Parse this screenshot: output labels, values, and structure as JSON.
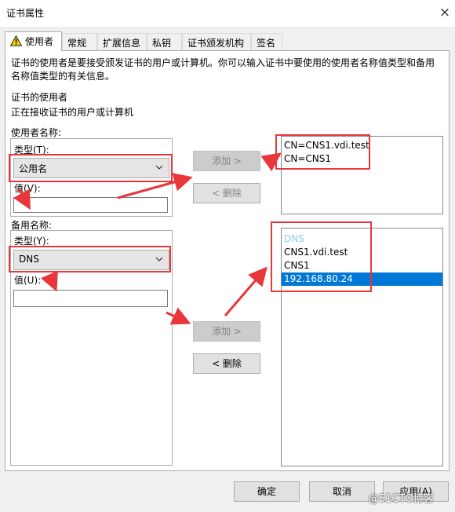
{
  "window": {
    "title": "证书属性",
    "close_glyph": "×"
  },
  "tabs": [
    {
      "label": "使用者",
      "active": true,
      "icon": "warning-icon"
    },
    {
      "label": "常规"
    },
    {
      "label": "扩展信息"
    },
    {
      "label": "私钥"
    },
    {
      "label": "证书颁发机构"
    },
    {
      "label": "签名"
    }
  ],
  "description": {
    "line1": "证书的使用者是要接受颁发证书的用户或计算机。你可以输入证书中要使用的使用者名称值类型和备用",
    "line2": "名称值类型的有关信息。"
  },
  "subject": {
    "heading": "证书的使用者",
    "text": "正在接收证书的用户或计算机"
  },
  "subject_name": {
    "group_label": "使用者名称:",
    "type_label": "类型(T):",
    "type_value": "公用名",
    "value_label": "值(V):",
    "value_input": "",
    "add_label": "添加 >",
    "remove_label": "< 删除",
    "list": [
      "CN=CNS1.vdi.test",
      "CN=CNS1"
    ]
  },
  "alt_name": {
    "group_label": "备用名称:",
    "type_label": "类型(Y):",
    "type_value": "DNS",
    "value_label": "值(U):",
    "value_input": "",
    "add_label": "添加 >",
    "remove_label": "< 删除",
    "list": [
      "DNS",
      "CNS1.vdi.test",
      "CNS1",
      "192.168.80.24"
    ],
    "selected_index": 3
  },
  "footer": {
    "ok_label": "确定",
    "cancel_label": "取消",
    "apply_label": "应用(A)"
  },
  "watermark": "@51CTO博客",
  "colors": {
    "annotation_red": "#e8363a",
    "selection_blue": "#0078d7",
    "category_text": "#8fcdf2"
  }
}
